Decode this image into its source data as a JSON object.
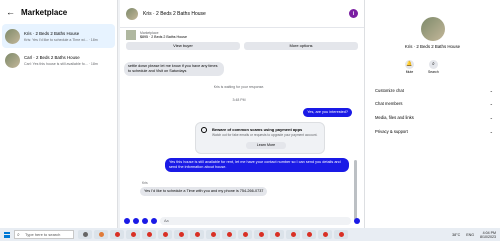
{
  "sidebar": {
    "title": "Marketplace",
    "conversations": [
      {
        "name": "Kris · 2 Beds 2 Baths House",
        "snippet": "Kris: Yes I'd like to schedule a Time wi... · 18m"
      },
      {
        "name": "Carl · 2 Beds 2 Baths House",
        "snippet": "Carl: Yes this house is still available fo... · 18m"
      }
    ]
  },
  "chat": {
    "title": "Kris · 2 Beds 2 Baths House",
    "listing_label": "Marketplace",
    "listing_title": "$895 · 2 Beds 2 Baths House",
    "view_buyer": "View buyer",
    "more_options": "More options",
    "messages": {
      "top_bubble": "settle down please let me know if you have any times to schedule and Visit on Saturdays",
      "waiting": "Kris is waiting for your response.",
      "time": "3:48 PM",
      "yes_interested": "Yes, are you interested?",
      "scam_title": "Beware of common scams using payment apps",
      "scam_sub": "Watch out for fake emails or requests to upgrade your payment account.",
      "learn_more": "Learn More",
      "available_msg": "Yes this house is still available for rent, let me have your contact number so I can send you details and send the information about house.",
      "sender": "Kris",
      "last_msg": "Yes I'd like to schedule a Time with you and my phone is 754-266-0737"
    },
    "composer_placeholder": "Aa"
  },
  "details": {
    "name": "Kris · 2 Beds 2 Baths House",
    "mute": "Mute",
    "search": "Search",
    "rows": [
      "Customize chat",
      "Chat members",
      "Media, files and links",
      "Privacy & support"
    ]
  },
  "taskbar": {
    "search_placeholder": "Type here to search",
    "weather": "38°C",
    "time": "4:04 PM",
    "date": "8/10/2023",
    "lang": "ENG"
  },
  "colors": {
    "accent": "#1a1ae6",
    "info": "#7b1fa2"
  }
}
